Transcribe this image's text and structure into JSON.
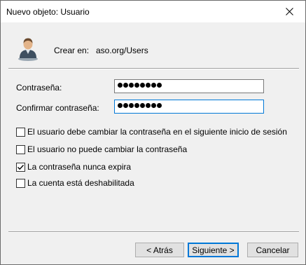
{
  "window": {
    "title": "Nuevo objeto: Usuario"
  },
  "icons": {
    "close": "close-icon",
    "avatar": "user-avatar-icon"
  },
  "header": {
    "create_in_label": "Crear en:",
    "create_in_value": "aso.org/Users"
  },
  "form": {
    "password_label": "Contraseña:",
    "password_dots": 8,
    "confirm_label": "Confirmar contraseña:",
    "confirm_dots": 8
  },
  "options": [
    {
      "label": "El usuario debe cambiar la contraseña en el siguiente inicio de sesión",
      "checked": false
    },
    {
      "label": "El usuario no puede cambiar la contraseña",
      "checked": false
    },
    {
      "label": "La contraseña nunca expira",
      "checked": true
    },
    {
      "label": "La cuenta está deshabilitada",
      "checked": false
    }
  ],
  "buttons": {
    "back": "< Atrás",
    "next": "Siguiente >",
    "cancel": "Cancelar"
  },
  "colors": {
    "accent": "#0078d7",
    "background": "#f0f0f0"
  }
}
